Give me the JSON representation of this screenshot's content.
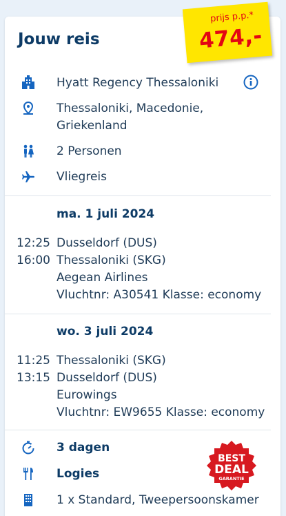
{
  "header": {
    "title": "Jouw reis"
  },
  "price": {
    "label": "prijs p.p.*",
    "value": "474,-"
  },
  "trip": {
    "hotel": "Hyatt Regency Thessaloniki",
    "location_line1": "Thessaloniki, Macedonie,",
    "location_line2": "Griekenland",
    "persons": "2 Personen",
    "travel_type": "Vliegreis"
  },
  "outbound": {
    "date": "ma. 1 juli 2024",
    "dep_time": "12:25",
    "dep_airport": "Dusseldorf (DUS)",
    "arr_time": "16:00",
    "arr_airport": "Thessaloniki (SKG)",
    "airline": "Aegean Airlines",
    "flight": "Vluchtnr: A30541 Klasse: economy"
  },
  "return": {
    "date": "wo. 3 juli 2024",
    "dep_time": "11:25",
    "dep_airport": "Thessaloniki (SKG)",
    "arr_time": "13:15",
    "arr_airport": "Dusseldorf (DUS)",
    "airline": "Eurowings",
    "flight": "Vluchtnr: EW9655 Klasse: economy"
  },
  "stay": {
    "duration": "3 dagen",
    "board": "Logies",
    "room": "1 x Standard, Tweepersoonskamer"
  },
  "seal": {
    "line1": "BEST",
    "line2": "DEAL",
    "line3": "GARANTIE"
  },
  "colors": {
    "accent": "#1565c0",
    "title": "#0d3b66",
    "price": "#e30613",
    "tag": "#ffe600",
    "seal": "#d71920"
  }
}
